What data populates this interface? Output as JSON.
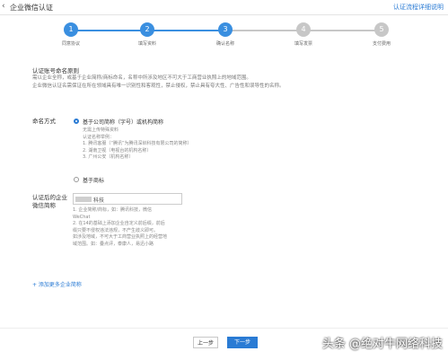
{
  "header": {
    "back_glyph": "‹",
    "title": "企业微信认证",
    "help_link": "认证流程详细说明"
  },
  "steps": [
    {
      "num": "1",
      "label": "同意协议"
    },
    {
      "num": "2",
      "label": "填写资料"
    },
    {
      "num": "3",
      "label": "确认名称"
    },
    {
      "num": "4",
      "label": "填写发票"
    },
    {
      "num": "5",
      "label": "支付费用"
    }
  ],
  "current_step": 3,
  "colors": {
    "accent": "#2a7bd4",
    "step_done": "#3a8fe0",
    "step_pending": "#c7c7c7"
  },
  "rules": {
    "title": "认证账号命名原则",
    "line1": "需以企业全称，或基于企业简称/商标命名，名称中所涉及地区不可大于工商营业执照上的地域范围。",
    "line2": "企业微信认证名需保证在所在领域具有唯一识别性和客观性，禁止侵权，禁止具有夸大性、广告性和误导性的名称。"
  },
  "naming": {
    "label": "命名方式",
    "option1": "基于公司简称（字号）或机构简称",
    "option1_hint": [
      "无需上传特殊资料",
      "认证名称举例：",
      "1. 腾讯客服（“腾讯”为腾讯深圳科技有限公司的简称）",
      "2. 湖南卫视（电视台的机构名称）",
      "3. 广州公安（机构名称）"
    ],
    "option2": "基于商标"
  },
  "short_name": {
    "label_line1": "认证后的企业",
    "label_line2": "微信简称",
    "value": "科技",
    "hints": [
      "1. 企业简称/商标，如：腾讯科技，微信",
      "WeChat",
      "2. 在14的基础上添加企业自定义前后缀，前后",
      "缀只要不侵权违法违规，不产生歧义即可。",
      "如涉及地域，不可大于工商营业执照上的经营地",
      "域范围。如：叠点评，泰康人，易迅小路"
    ]
  },
  "add_more": "+ 添加更多企业简称",
  "buttons": {
    "prev": "上一步",
    "next": "下一步"
  },
  "watermark": "头条 @绝对牛网络科技"
}
